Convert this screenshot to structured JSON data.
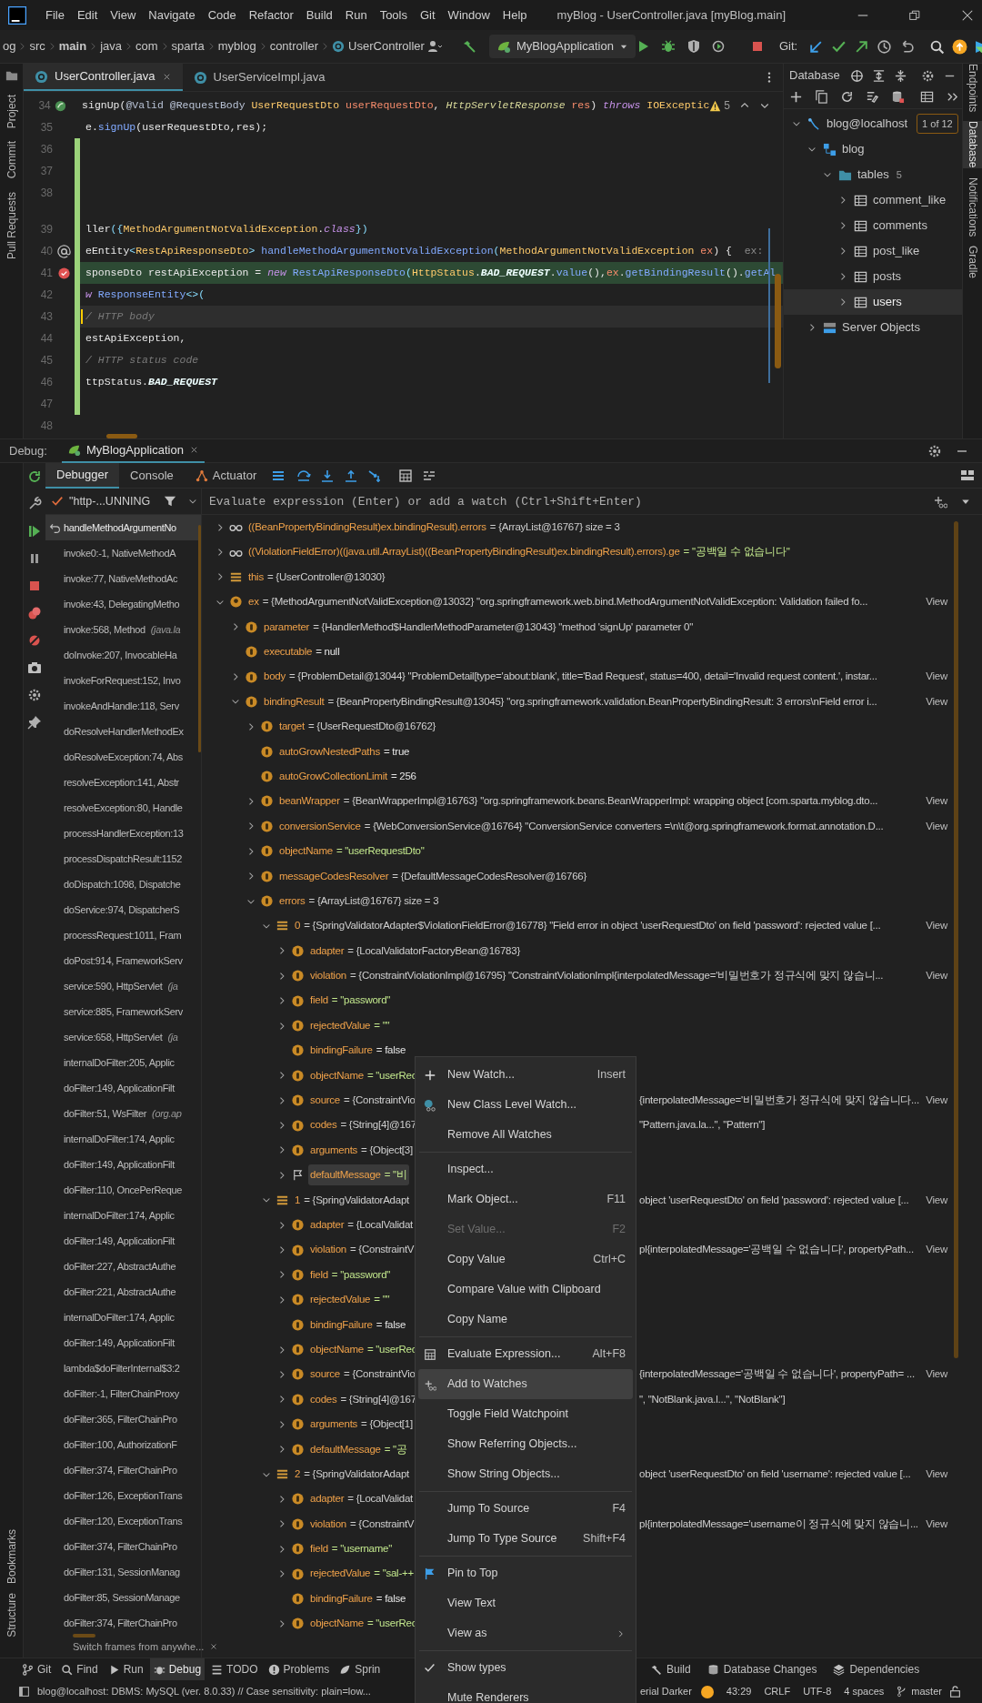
{
  "menu_bar": {
    "items": [
      "File",
      "Edit",
      "View",
      "Navigate",
      "Code",
      "Refactor",
      "Build",
      "Run",
      "Tools",
      "Git",
      "Window",
      "Help"
    ],
    "title": "myBlog - UserController.java [myBlog.main]"
  },
  "breadcrumbs": [
    {
      "text": "og",
      "kind": "folder"
    },
    {
      "text": "src",
      "kind": "folder"
    },
    {
      "text": "main",
      "kind": "root"
    },
    {
      "text": "java",
      "kind": "folder"
    },
    {
      "text": "com",
      "kind": "folder"
    },
    {
      "text": "sparta",
      "kind": "folder"
    },
    {
      "text": "myblog",
      "kind": "folder"
    },
    {
      "text": "controller",
      "kind": "folder"
    },
    {
      "text": "UserController",
      "kind": "class"
    }
  ],
  "run_config": "MyBlogApplication",
  "git_label": "Git:",
  "left_tools_top": [
    "Project",
    "Commit",
    "Pull Requests"
  ],
  "left_tools_bottom": [
    "Bookmarks",
    "Structure"
  ],
  "right_tools": [
    {
      "label": "Endpoints",
      "selected": false
    },
    {
      "label": "Database",
      "selected": true
    },
    {
      "label": "Notifications",
      "selected": false
    },
    {
      "label": "Gradle",
      "selected": false
    }
  ],
  "editor_tabs": [
    {
      "label": "UserController.java",
      "selected": true
    },
    {
      "label": "UserServiceImpl.java",
      "selected": false
    }
  ],
  "editor": {
    "warnings": "5",
    "lines": [
      {
        "number": "34",
        "kind": "bean",
        "execution": false,
        "caret": false,
        "changed": false,
        "tokens": [
          {
            "text": "signUp(",
            "kind": "plain"
          },
          {
            "text": "@Valid @RequestBody ",
            "kind": "ann"
          },
          {
            "text": "UserRequestDto ",
            "kind": "type"
          },
          {
            "text": "userRequestDto",
            "kind": "param"
          },
          {
            "text": ", ",
            "kind": "plain"
          },
          {
            "text": "HttpServletResponse ",
            "kind": "itype"
          },
          {
            "text": "res",
            "kind": "param"
          },
          {
            "text": ") ",
            "kind": "plain"
          },
          {
            "text": "throws ",
            "kind": "kw"
          },
          {
            "text": "IOExceptic",
            "kind": "type"
          }
        ]
      },
      {
        "number": "35",
        "kind": "plain",
        "execution": false,
        "caret": false,
        "changed": false,
        "tokens": [
          {
            "text": "e.",
            "kind": "plain"
          },
          {
            "text": "signUp",
            "kind": "method"
          },
          {
            "text": "(userRequestDto,res);",
            "kind": "plain"
          }
        ]
      },
      {
        "number": "36",
        "kind": "plain",
        "execution": false,
        "caret": false,
        "changed": true
      },
      {
        "number": "37",
        "kind": "plain",
        "execution": false,
        "caret": false,
        "changed": true
      },
      {
        "number": "38",
        "kind": "plain",
        "execution": false,
        "caret": false,
        "changed": true
      },
      {
        "kind": "inlay",
        "changed": true
      },
      {
        "number": "39",
        "kind": "plain",
        "execution": false,
        "caret": false,
        "changed": true,
        "tokens": [
          {
            "text": "ller",
            "kind": "plain"
          },
          {
            "text": "({",
            "kind": "punct"
          },
          {
            "text": "MethodArgumentNotValidException",
            "kind": "type"
          },
          {
            "text": ".",
            "kind": "plain"
          },
          {
            "text": "class",
            "kind": "kw"
          },
          {
            "text": "})",
            "kind": "punct"
          }
        ]
      },
      {
        "number": "40",
        "kind": "annotation",
        "execution": false,
        "caret": false,
        "changed": true,
        "tokens": [
          {
            "text": "eEntity",
            "kind": "plain"
          },
          {
            "text": "<",
            "kind": "punct"
          },
          {
            "text": "RestApiResponseDto",
            "kind": "type"
          },
          {
            "text": "> ",
            "kind": "punct"
          },
          {
            "text": "handleMethodArgumentNotValidException",
            "kind": "method"
          },
          {
            "text": "(",
            "kind": "punct"
          },
          {
            "text": "MethodArgumentNotValidException ",
            "kind": "type"
          },
          {
            "text": "ex",
            "kind": "param"
          },
          {
            "text": ") {",
            "kind": "plain"
          },
          {
            "text": "  ex:",
            "kind": "hint"
          }
        ]
      },
      {
        "number": "41",
        "kind": "breakpoint",
        "execution": true,
        "caret": false,
        "changed": true,
        "tokens": [
          {
            "text": "sponseDto ",
            "kind": "plain"
          },
          {
            "text": "restApiException = ",
            "kind": "plain"
          },
          {
            "text": "new ",
            "kind": "kw"
          },
          {
            "text": "RestApiResponseDto",
            "kind": "method"
          },
          {
            "text": "(",
            "kind": "punct"
          },
          {
            "text": "HttpStatus",
            "kind": "type"
          },
          {
            "text": ".",
            "kind": "plain"
          },
          {
            "text": "BAD_REQUEST",
            "kind": "const"
          },
          {
            "text": ".",
            "kind": "plain"
          },
          {
            "text": "value",
            "kind": "method"
          },
          {
            "text": "(),",
            "kind": "plain"
          },
          {
            "text": "ex",
            "kind": "param"
          },
          {
            "text": ".",
            "kind": "plain"
          },
          {
            "text": "getBindingResult",
            "kind": "method"
          },
          {
            "text": "().",
            "kind": "plain"
          },
          {
            "text": "getAl",
            "kind": "method"
          }
        ]
      },
      {
        "number": "42",
        "kind": "plain",
        "execution": false,
        "caret": false,
        "changed": true,
        "tokens": [
          {
            "text": "w ",
            "kind": "kw"
          },
          {
            "text": "ResponseEntity",
            "kind": "method"
          },
          {
            "text": "<>(",
            "kind": "punct"
          }
        ]
      },
      {
        "number": "43",
        "kind": "plain",
        "execution": false,
        "caret": true,
        "changed": true,
        "tokens": [
          {
            "text": "/ HTTP body",
            "kind": "comment"
          }
        ]
      },
      {
        "number": "44",
        "kind": "plain",
        "execution": false,
        "caret": false,
        "changed": true,
        "tokens": [
          {
            "text": "estApiException,",
            "kind": "plain"
          }
        ]
      },
      {
        "number": "45",
        "kind": "plain",
        "execution": false,
        "caret": false,
        "changed": true,
        "tokens": [
          {
            "text": "/ HTTP status code",
            "kind": "comment"
          }
        ]
      },
      {
        "number": "46",
        "kind": "plain",
        "execution": false,
        "caret": false,
        "changed": true,
        "tokens": [
          {
            "text": "ttpStatus.",
            "kind": "plain"
          },
          {
            "text": "BAD_REQUEST",
            "kind": "const"
          }
        ]
      },
      {
        "number": "47",
        "kind": "plain",
        "execution": false,
        "caret": false,
        "changed": true
      },
      {
        "number": "48",
        "kind": "plain",
        "execution": false,
        "caret": false,
        "changed": false
      }
    ]
  },
  "database": {
    "title": "Database",
    "tree": [
      {
        "label": "blog@localhost",
        "kind": "connection",
        "badge": "1 of 12",
        "expanded": true,
        "selected": false,
        "children": [
          {
            "label": "blog",
            "kind": "schema",
            "expanded": true,
            "selected": false,
            "children": [
              {
                "label": "tables",
                "count": "5",
                "kind": "folder",
                "expanded": true,
                "selected": false,
                "children": [
                  {
                    "label": "comment_like",
                    "kind": "table",
                    "expanded": false,
                    "selected": false
                  },
                  {
                    "label": "comments",
                    "kind": "table",
                    "expanded": false,
                    "selected": false
                  },
                  {
                    "label": "post_like",
                    "kind": "table",
                    "expanded": false,
                    "selected": false
                  },
                  {
                    "label": "posts",
                    "kind": "table",
                    "expanded": false,
                    "selected": false
                  },
                  {
                    "label": "users",
                    "kind": "table",
                    "expanded": false,
                    "selected": true
                  }
                ]
              }
            ]
          },
          {
            "label": "Server Objects",
            "kind": "server",
            "expanded": false,
            "selected": false
          }
        ]
      }
    ]
  },
  "debug": {
    "label": "Debug:",
    "session": "MyBlogApplication",
    "tabs": [
      {
        "label": "Debugger",
        "selected": true,
        "kind": "plain"
      },
      {
        "label": "Console",
        "selected": false,
        "kind": "plain"
      },
      {
        "label": "Actuator",
        "selected": false,
        "kind": "actuator"
      }
    ],
    "thread": "\"http-...UNNING",
    "eval_placeholder": "Evaluate expression (Enter) or add a watch (Ctrl+Shift+Enter)",
    "frames": [
      {
        "text": "handleMethodArgumentNo",
        "selected": true
      },
      {
        "text": "invoke0:-1, NativeMethodA",
        "selected": false
      },
      {
        "text": "invoke:77, NativeMethodAc",
        "selected": false
      },
      {
        "text": "invoke:43, DelegatingMetho",
        "selected": false
      },
      {
        "text": "invoke:568, Method",
        "package": "(java.la",
        "selected": false
      },
      {
        "text": "doInvoke:207, InvocableHa",
        "selected": false
      },
      {
        "text": "invokeForRequest:152, Invo",
        "selected": false
      },
      {
        "text": "invokeAndHandle:118, Serv",
        "selected": false
      },
      {
        "text": "doResolveHandlerMethodEx",
        "selected": false
      },
      {
        "text": "doResolveException:74, Abs",
        "selected": false
      },
      {
        "text": "resolveException:141, Abstr",
        "selected": false
      },
      {
        "text": "resolveException:80, Handle",
        "selected": false
      },
      {
        "text": "processHandlerException:13",
        "selected": false
      },
      {
        "text": "processDispatchResult:1152",
        "selected": false
      },
      {
        "text": "doDispatch:1098, Dispatche",
        "selected": false
      },
      {
        "text": "doService:974, DispatcherS",
        "selected": false
      },
      {
        "text": "processRequest:1011, Fram",
        "selected": false
      },
      {
        "text": "doPost:914, FrameworkServ",
        "selected": false
      },
      {
        "text": "service:590, HttpServlet",
        "package": "(ja",
        "selected": false
      },
      {
        "text": "service:885, FrameworkServ",
        "selected": false
      },
      {
        "text": "service:658, HttpServlet",
        "package": "(ja",
        "selected": false
      },
      {
        "text": "internalDoFilter:205, Applic",
        "selected": false
      },
      {
        "text": "doFilter:149, ApplicationFilt",
        "selected": false
      },
      {
        "text": "doFilter:51, WsFilter",
        "package": "(org.ap",
        "selected": false
      },
      {
        "text": "internalDoFilter:174, Applic",
        "selected": false
      },
      {
        "text": "doFilter:149, ApplicationFilt",
        "selected": false
      },
      {
        "text": "doFilter:110, OncePerReque",
        "selected": false
      },
      {
        "text": "internalDoFilter:174, Applic",
        "selected": false
      },
      {
        "text": "doFilter:149, ApplicationFilt",
        "selected": false
      },
      {
        "text": "doFilter:227, AbstractAuthe",
        "selected": false
      },
      {
        "text": "doFilter:221, AbstractAuthe",
        "selected": false
      },
      {
        "text": "internalDoFilter:174, Applic",
        "selected": false
      },
      {
        "text": "doFilter:149, ApplicationFilt",
        "selected": false
      },
      {
        "text": "lambda$doFilterInternal$3:2",
        "selected": false
      },
      {
        "text": "doFilter:-1, FilterChainProxy",
        "selected": false
      },
      {
        "text": "doFilter:365, FilterChainPro",
        "selected": false
      },
      {
        "text": "doFilter:100, AuthorizationF",
        "selected": false
      },
      {
        "text": "doFilter:374, FilterChainPro",
        "selected": false
      },
      {
        "text": "doFilter:126, ExceptionTrans",
        "selected": false
      },
      {
        "text": "doFilter:120, ExceptionTrans",
        "selected": false
      },
      {
        "text": "doFilter:374, FilterChainPro",
        "selected": false
      },
      {
        "text": "doFilter:131, SessionManag",
        "selected": false
      },
      {
        "text": "doFilter:85, SessionManage",
        "selected": false
      },
      {
        "text": "doFilter:374, FilterChainPro",
        "selected": false
      }
    ],
    "frames_hint": "Switch frames from anywhe...",
    "variables": [
      {
        "kind": "watch",
        "name": "((BeanPropertyBindingResult)ex.bindingResult).errors",
        "value": {
          "text": "= {ArrayList@16767}  size = 3",
          "kind": "object"
        },
        "expanded": false,
        "selected": false
      },
      {
        "kind": "watch",
        "name": "((ViolationFieldError)((java.util.ArrayList)((BeanPropertyBindingResult)ex.bindingResult).errors).ge",
        "value": {
          "text": "= \"공백일 수 없습니다\"",
          "kind": "string"
        },
        "expanded": false,
        "selected": false
      },
      {
        "kind": "list",
        "name": "this",
        "value": {
          "text": "= {UserController@13030}",
          "kind": "object"
        },
        "expanded": false,
        "selected": false
      },
      {
        "kind": "param",
        "name": "ex",
        "value": {
          "text": "= {MethodArgumentNotValidException@13032} \"org.springframework.web.bind.MethodArgumentNotValidException: Validation failed fo...",
          "kind": "object"
        },
        "link": "View",
        "expanded": true,
        "selected": false,
        "children": [
          {
            "kind": "field",
            "name": "parameter",
            "value": {
              "text": "= {HandlerMethod$HandlerMethodParameter@13043} \"method 'signUp' parameter 0\"",
              "kind": "object"
            },
            "expanded": false,
            "selected": false
          },
          {
            "kind": "field",
            "name": "executable",
            "value": {
              "text": "= null",
              "kind": "primitive"
            },
            "selected": false
          },
          {
            "kind": "field",
            "name": "body",
            "value": {
              "text": "= {ProblemDetail@13044} \"ProblemDetail[type='about:blank', title='Bad Request', status=400, detail='Invalid request content.', instar...",
              "kind": "object"
            },
            "link": "View",
            "expanded": false,
            "selected": false
          },
          {
            "kind": "field",
            "name": "bindingResult",
            "value": {
              "text": "= {BeanPropertyBindingResult@13045} \"org.springframework.validation.BeanPropertyBindingResult: 3 errors\\nField error i...",
              "kind": "object"
            },
            "link": "View",
            "expanded": true,
            "selected": false,
            "children": [
              {
                "kind": "field",
                "name": "target",
                "value": {
                  "text": "= {UserRequestDto@16762}",
                  "kind": "object"
                },
                "expanded": false,
                "selected": false
              },
              {
                "kind": "field",
                "name": "autoGrowNestedPaths",
                "value": {
                  "text": "= true",
                  "kind": "primitive"
                },
                "selected": false
              },
              {
                "kind": "field",
                "name": "autoGrowCollectionLimit",
                "value": {
                  "text": "= 256",
                  "kind": "primitive"
                },
                "selected": false
              },
              {
                "kind": "field",
                "name": "beanWrapper",
                "value": {
                  "text": "= {BeanWrapperImpl@16763} \"org.springframework.beans.BeanWrapperImpl: wrapping object [com.sparta.myblog.dto...",
                  "kind": "object"
                },
                "link": "View",
                "expanded": false,
                "selected": false
              },
              {
                "kind": "field",
                "name": "conversionService",
                "value": {
                  "text": "= {WebConversionService@16764} \"ConversionService converters =\\n\\t@org.springframework.format.annotation.D...",
                  "kind": "object"
                },
                "link": "View",
                "expanded": false,
                "selected": false
              },
              {
                "kind": "field",
                "name": "objectName",
                "value": {
                  "text": "= \"userRequestDto\"",
                  "kind": "string"
                },
                "expanded": false,
                "selected": false
              },
              {
                "kind": "field",
                "name": "messageCodesResolver",
                "value": {
                  "text": "= {DefaultMessageCodesResolver@16766}",
                  "kind": "object"
                },
                "expanded": false,
                "selected": false
              },
              {
                "kind": "field",
                "name": "errors",
                "value": {
                  "text": "= {ArrayList@16767}  size = 3",
                  "kind": "object"
                },
                "expanded": true,
                "selected": false,
                "children": [
                  {
                    "kind": "list",
                    "name": "0",
                    "value": {
                      "text": "= {SpringValidatorAdapter$ViolationFieldError@16778} \"Field error in object 'userRequestDto' on field 'password': rejected value [...",
                      "kind": "object"
                    },
                    "link": "View",
                    "expanded": true,
                    "selected": false,
                    "children": [
                      {
                        "kind": "field",
                        "name": "adapter",
                        "value": {
                          "text": "= {LocalValidatorFactoryBean@16783}",
                          "kind": "object"
                        },
                        "expanded": false,
                        "selected": false
                      },
                      {
                        "kind": "field",
                        "name": "violation",
                        "value": {
                          "text": "= {ConstraintViolationImpl@16795} \"ConstraintViolationImpl{interpolatedMessage='비밀번호가 정규식에 맞지 않습니...",
                          "kind": "object"
                        },
                        "link": "View",
                        "expanded": false,
                        "selected": false
                      },
                      {
                        "kind": "field",
                        "name": "field",
                        "value": {
                          "text": "= \"password\"",
                          "kind": "string"
                        },
                        "expanded": false,
                        "selected": false
                      },
                      {
                        "kind": "field",
                        "name": "rejectedValue",
                        "value": {
                          "text": "= \"\"",
                          "kind": "string"
                        },
                        "expanded": false,
                        "selected": false
                      },
                      {
                        "kind": "field",
                        "name": "bindingFailure",
                        "value": {
                          "text": "= false",
                          "kind": "primitive"
                        },
                        "selected": false
                      },
                      {
                        "kind": "field",
                        "name": "objectName",
                        "value": {
                          "text": "= \"userRec",
                          "kind": "string"
                        },
                        "expanded": false,
                        "selected": false
                      },
                      {
                        "kind": "field",
                        "name": "source",
                        "value": {
                          "text": "= {ConstraintVio",
                          "kind": "object"
                        },
                        "value_after_menu": "{interpolatedMessage='비밀번호가 정규식에 맞지 않습니다...",
                        "link": "View",
                        "expanded": false,
                        "selected": false
                      },
                      {
                        "kind": "field",
                        "name": "codes",
                        "value": {
                          "text": "= {String[4]@167",
                          "kind": "object"
                        },
                        "value_after_menu": "\"Pattern.java.la...\", \"Pattern\"]",
                        "expanded": false,
                        "selected": false
                      },
                      {
                        "kind": "field",
                        "name": "arguments",
                        "value": {
                          "text": "= {Object[3]",
                          "kind": "object"
                        },
                        "expanded": false,
                        "selected": false
                      },
                      {
                        "kind": "flag",
                        "name": "defaultMessage",
                        "value": {
                          "text": "= \"비",
                          "kind": "string"
                        },
                        "expanded": false,
                        "selected": true
                      }
                    ]
                  },
                  {
                    "kind": "list",
                    "name": "1",
                    "value": {
                      "text": "= {SpringValidatorAdapt",
                      "kind": "object"
                    },
                    "value_after_menu": "object 'userRequestDto' on field 'password': rejected value [...",
                    "link": "View",
                    "expanded": true,
                    "selected": false,
                    "children": [
                      {
                        "kind": "field",
                        "name": "adapter",
                        "value": {
                          "text": "= {LocalValidat",
                          "kind": "object"
                        },
                        "expanded": false,
                        "selected": false
                      },
                      {
                        "kind": "field",
                        "name": "violation",
                        "value": {
                          "text": "= {ConstraintV",
                          "kind": "object"
                        },
                        "value_after_menu": "pl{interpolatedMessage='공백일 수 없습니다', propertyPath...",
                        "link": "View",
                        "expanded": false,
                        "selected": false
                      },
                      {
                        "kind": "field",
                        "name": "field",
                        "value": {
                          "text": "= \"password\"",
                          "kind": "string"
                        },
                        "expanded": false,
                        "selected": false
                      },
                      {
                        "kind": "field",
                        "name": "rejectedValue",
                        "value": {
                          "text": "= \"\"",
                          "kind": "string"
                        },
                        "expanded": false,
                        "selected": false
                      },
                      {
                        "kind": "field",
                        "name": "bindingFailure",
                        "value": {
                          "text": "= false",
                          "kind": "primitive"
                        },
                        "selected": false
                      },
                      {
                        "kind": "field",
                        "name": "objectName",
                        "value": {
                          "text": "= \"userRec",
                          "kind": "string"
                        },
                        "expanded": false,
                        "selected": false
                      },
                      {
                        "kind": "field",
                        "name": "source",
                        "value": {
                          "text": "= {ConstraintVio",
                          "kind": "object"
                        },
                        "value_after_menu": "{interpolatedMessage='공백일 수 없습니다', propertyPath= ...",
                        "link": "View",
                        "expanded": false,
                        "selected": false
                      },
                      {
                        "kind": "field",
                        "name": "codes",
                        "value": {
                          "text": "= {String[4]@167",
                          "kind": "object"
                        },
                        "value_after_menu": "\", \"NotBlank.java.l...\", \"NotBlank\"]",
                        "expanded": false,
                        "selected": false
                      },
                      {
                        "kind": "field",
                        "name": "arguments",
                        "value": {
                          "text": "= {Object[1]",
                          "kind": "object"
                        },
                        "expanded": false,
                        "selected": false
                      },
                      {
                        "kind": "field",
                        "name": "defaultMessage",
                        "value": {
                          "text": "= \"공",
                          "kind": "string"
                        },
                        "expanded": false,
                        "selected": false
                      }
                    ]
                  },
                  {
                    "kind": "list",
                    "name": "2",
                    "value": {
                      "text": "= {SpringValidatorAdapt",
                      "kind": "object"
                    },
                    "value_after_menu": "object 'userRequestDto' on field 'username': rejected value [...",
                    "link": "View",
                    "expanded": true,
                    "selected": false,
                    "children": [
                      {
                        "kind": "field",
                        "name": "adapter",
                        "value": {
                          "text": "= {LocalValidat",
                          "kind": "object"
                        },
                        "expanded": false,
                        "selected": false
                      },
                      {
                        "kind": "field",
                        "name": "violation",
                        "value": {
                          "text": "= {ConstraintV",
                          "kind": "object"
                        },
                        "value_after_menu": "pl{interpolatedMessage='username이 정규식에 맞지 않습니...",
                        "link": "View",
                        "expanded": false,
                        "selected": false
                      },
                      {
                        "kind": "field",
                        "name": "field",
                        "value": {
                          "text": "= \"username\"",
                          "kind": "string"
                        },
                        "expanded": false,
                        "selected": false
                      },
                      {
                        "kind": "field",
                        "name": "rejectedValue",
                        "value": {
                          "text": "= \"sal-++",
                          "kind": "string"
                        },
                        "expanded": false,
                        "selected": false
                      },
                      {
                        "kind": "field",
                        "name": "bindingFailure",
                        "value": {
                          "text": "= false",
                          "kind": "primitive"
                        },
                        "selected": false
                      },
                      {
                        "kind": "field",
                        "name": "objectName",
                        "value": {
                          "text": "= \"userRec",
                          "kind": "string"
                        },
                        "expanded": false,
                        "selected": false
                      }
                    ]
                  }
                ]
              }
            ]
          }
        ]
      }
    ]
  },
  "context_menu": {
    "items": [
      {
        "label": "New Watch...",
        "shortcut": "Insert",
        "kind": "plus",
        "disabled": false,
        "selected": false,
        "checked": false
      },
      {
        "label": "New Class Level Watch...",
        "kind": "classwatch",
        "disabled": false,
        "selected": false,
        "checked": false
      },
      {
        "label": "Remove All Watches",
        "kind": "plain",
        "disabled": false,
        "selected": false,
        "checked": false,
        "separator_after": true
      },
      {
        "label": "Inspect...",
        "kind": "plain",
        "disabled": false,
        "selected": false,
        "checked": false
      },
      {
        "label": "Mark Object...",
        "shortcut": "F11",
        "kind": "plain",
        "disabled": false,
        "selected": false,
        "checked": false
      },
      {
        "label": "Set Value...",
        "shortcut": "F2",
        "kind": "plain",
        "disabled": true,
        "selected": false,
        "checked": false
      },
      {
        "label": "Copy Value",
        "shortcut": "Ctrl+C",
        "kind": "plain",
        "disabled": false,
        "selected": false,
        "checked": false
      },
      {
        "label": "Compare Value with Clipboard",
        "kind": "plain",
        "disabled": false,
        "selected": false,
        "checked": false
      },
      {
        "label": "Copy Name",
        "kind": "plain",
        "disabled": false,
        "selected": false,
        "checked": false,
        "separator_after": true
      },
      {
        "label": "Evaluate Expression...",
        "shortcut": "Alt+F8",
        "kind": "calculator",
        "disabled": false,
        "selected": false,
        "checked": false
      },
      {
        "label": "Add to Watches",
        "kind": "addwatch",
        "disabled": false,
        "selected": true,
        "checked": false
      },
      {
        "label": "Toggle Field Watchpoint",
        "kind": "plain",
        "disabled": false,
        "selected": false,
        "checked": false
      },
      {
        "label": "Show Referring Objects...",
        "kind": "plain",
        "disabled": false,
        "selected": false,
        "checked": false
      },
      {
        "label": "Show String Objects...",
        "kind": "plain",
        "disabled": false,
        "selected": false,
        "checked": false,
        "separator_after": true
      },
      {
        "label": "Jump To Source",
        "shortcut": "F4",
        "kind": "plain",
        "disabled": false,
        "selected": false,
        "checked": false
      },
      {
        "label": "Jump To Type Source",
        "shortcut": "Shift+F4",
        "kind": "plain",
        "disabled": false,
        "selected": false,
        "checked": false,
        "separator_after": true
      },
      {
        "label": "Pin to Top",
        "kind": "pin",
        "disabled": false,
        "selected": false,
        "checked": false
      },
      {
        "label": "View Text",
        "kind": "plain",
        "disabled": false,
        "selected": false,
        "checked": false
      },
      {
        "label": "View as",
        "kind": "submenu",
        "disabled": false,
        "selected": false,
        "checked": false,
        "separator_after": true
      },
      {
        "label": "Show types",
        "kind": "toggle",
        "disabled": false,
        "selected": false,
        "checked": true
      },
      {
        "label": "Mute Renderers",
        "kind": "toggle",
        "disabled": false,
        "selected": false,
        "checked": false
      }
    ]
  },
  "tool_windows_left": [
    {
      "label": "Git",
      "kind": "branch",
      "selected": false
    },
    {
      "label": "Find",
      "kind": "search",
      "selected": false
    },
    {
      "label": "Run",
      "kind": "play",
      "selected": false
    },
    {
      "label": "Debug",
      "kind": "bug",
      "selected": true
    },
    {
      "label": "TODO",
      "kind": "list",
      "selected": false
    },
    {
      "label": "Problems",
      "kind": "problems",
      "selected": false
    },
    {
      "label": "Sprin",
      "kind": "leaf",
      "selected": false
    }
  ],
  "tool_windows_right": [
    {
      "label": "Build",
      "kind": "hammer",
      "selected": false
    },
    {
      "label": "Database Changes",
      "kind": "database",
      "selected": false
    },
    {
      "label": "Dependencies",
      "kind": "layers",
      "selected": false
    }
  ],
  "status_bar": {
    "message": "blog@localhost: DBMS: MySQL (ver. 8.0.33) // Case sensitivity: plain=low...",
    "theme": "erial Darker",
    "position": "43:29",
    "line_separator": "CRLF",
    "encoding": "UTF-8",
    "indent": "4 spaces",
    "branch": "master"
  }
}
